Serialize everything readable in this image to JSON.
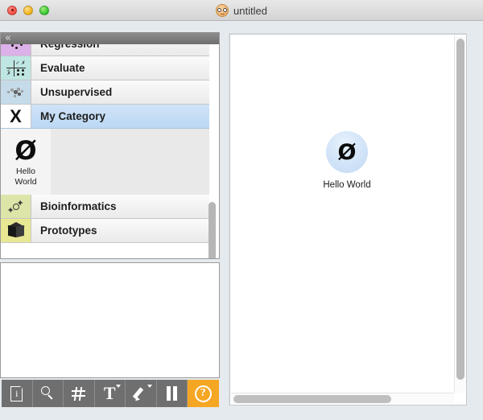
{
  "window": {
    "title": "untitled",
    "app_icon": "nerd-face-icon",
    "traffic_lights": [
      "close",
      "minimize",
      "zoom"
    ]
  },
  "sidebar": {
    "collapse_icon": "«",
    "categories": [
      {
        "label": "Regression",
        "icon": "scatter-dots-icon",
        "selected": false,
        "clipped": true
      },
      {
        "label": "Evaluate",
        "icon": "grid-check-icon",
        "selected": false,
        "clipped": false
      },
      {
        "label": "Unsupervised",
        "icon": "cluster-icon",
        "selected": false,
        "clipped": false
      },
      {
        "label": "My Category",
        "icon": "x-mark-icon",
        "selected": true,
        "clipped": false
      },
      {
        "label": "Bioinformatics",
        "icon": "molecule-icon",
        "selected": false,
        "clipped": false
      },
      {
        "label": "Prototypes",
        "icon": "cube-icon",
        "selected": false,
        "clipped": false
      }
    ],
    "widgets": [
      {
        "glyph": "Ø",
        "name_line1": "Hello",
        "name_line2": "World"
      }
    ]
  },
  "toolbar": {
    "buttons": [
      {
        "name": "info-document-icon",
        "glyph": "",
        "accent": false,
        "caret": false
      },
      {
        "name": "search-icon",
        "glyph": "",
        "accent": false,
        "caret": false
      },
      {
        "name": "grid-icon",
        "glyph": "",
        "accent": false,
        "caret": false
      },
      {
        "name": "text-icon",
        "glyph": "T",
        "accent": false,
        "caret": true
      },
      {
        "name": "pencil-icon",
        "glyph": "",
        "accent": false,
        "caret": true
      },
      {
        "name": "pause-icon",
        "glyph": "",
        "accent": false,
        "caret": false
      },
      {
        "name": "help-icon",
        "glyph": "?",
        "accent": true,
        "caret": false
      }
    ],
    "accent_color": "#f5a623"
  },
  "canvas": {
    "nodes": [
      {
        "glyph": "Ø",
        "label": "Hello World",
        "color": "#cfe2f7"
      }
    ]
  }
}
